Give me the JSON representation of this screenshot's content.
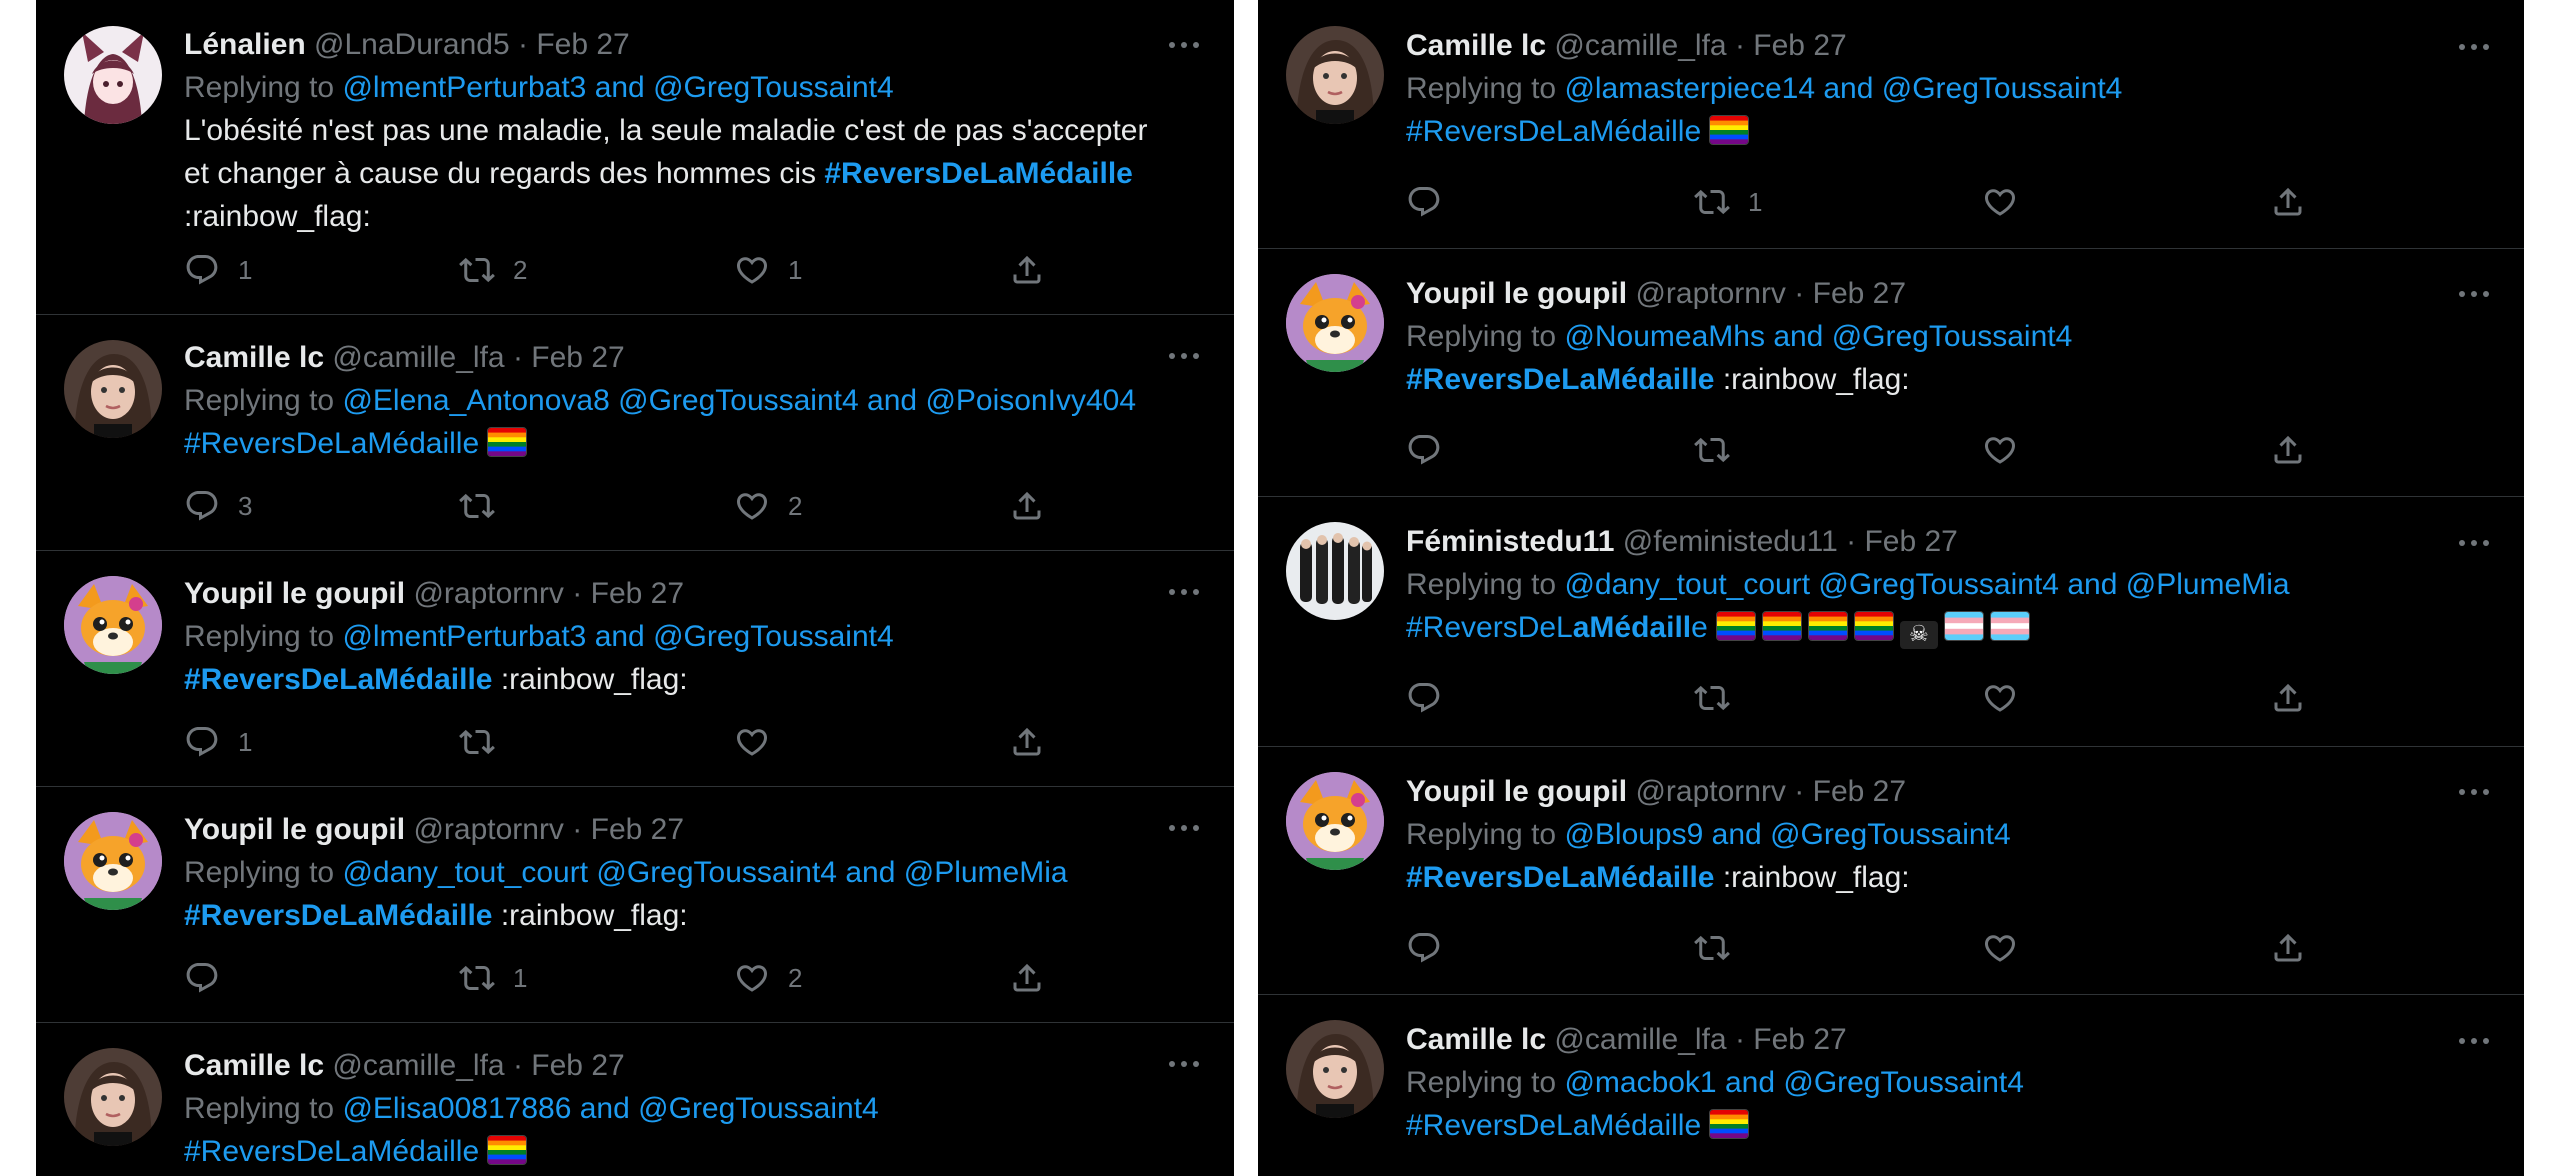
{
  "left": {
    "tweets": [
      {
        "name": "Lénalien",
        "handle": "@LnaDurand5",
        "date": "Feb 27",
        "reply_prefix": "Replying to",
        "mention1": "@lmentPerturbat3",
        "and": "and",
        "mention2": "@GregToussaint4",
        "text_line1": "L'obésité n'est pas une maladie, la seule maladie c'est de pas s'accepter",
        "text_line2": "et changer à cause du regards des hommes cis",
        "hashtag": "#ReversDeLaMédaille",
        "text_line3": ":rainbow_flag:",
        "replies": "1",
        "retweets": "2",
        "likes": "1"
      },
      {
        "name": "Camille lc",
        "handle": "@camille_lfa",
        "date": "Feb 27",
        "reply_prefix": "Replying to",
        "mention1": "@Elena_Antonova8",
        "mention2": "@GregToussaint4",
        "and": "and",
        "mention3": "@PoisonIvy404",
        "hashtag": "#ReversDeLaMédaille",
        "replies": "3",
        "retweets": "",
        "likes": "2"
      },
      {
        "name": "Youpil le goupil",
        "handle": "@raptornrv",
        "date": "Feb 27",
        "reply_prefix": "Replying to",
        "mention1": "@lmentPerturbat3",
        "and": "and",
        "mention2": "@GregToussaint4",
        "hashtag": "#ReversDeLaMédaille",
        "emoji_text": ":rainbow_flag:",
        "replies": "1",
        "retweets": "",
        "likes": ""
      },
      {
        "name": "Youpil le goupil",
        "handle": "@raptornrv",
        "date": "Feb 27",
        "reply_prefix": "Replying to",
        "mention1": "@dany_tout_court",
        "mention2": "@GregToussaint4",
        "and": "and",
        "mention3": "@PlumeMia",
        "hashtag": "#ReversDeLaMédaille",
        "emoji_text": ":rainbow_flag:",
        "replies": "",
        "retweets": "1",
        "likes": "2"
      },
      {
        "name": "Camille lc",
        "handle": "@camille_lfa",
        "date": "Feb 27",
        "reply_prefix": "Replying to",
        "mention1": "@Elisa00817886",
        "and": "and",
        "mention2": "@GregToussaint4",
        "hashtag": "#ReversDeLaMédaille"
      }
    ]
  },
  "right": {
    "tweets": [
      {
        "name": "Camille lc",
        "handle": "@camille_lfa",
        "date": "Feb 27",
        "reply_prefix": "Replying to",
        "mention1": "@lamasterpiece14",
        "and": "and",
        "mention2": "@GregToussaint4",
        "hashtag": "#ReversDeLaMédaille",
        "replies": "",
        "retweets": "1",
        "likes": ""
      },
      {
        "name": "Youpil le goupil",
        "handle": "@raptornrv",
        "date": "Feb 27",
        "reply_prefix": "Replying to",
        "mention1": "@NoumeaMhs",
        "and": "and",
        "mention2": "@GregToussaint4",
        "hashtag": "#ReversDeLaMédaille",
        "emoji_text": ":rainbow_flag:",
        "replies": "",
        "retweets": "",
        "likes": ""
      },
      {
        "name": "Féministedu11",
        "handle": "@feministedu11",
        "date": "Feb 27",
        "reply_prefix": "Replying to",
        "mention1": "@dany_tout_court",
        "mention2": "@GregToussaint4",
        "and": "and",
        "mention3": "@PlumeMia",
        "hashtag_a": "#ReversDeL",
        "hashtag_b": "aMédaill",
        "hashtag_c": "e",
        "skull": "☠",
        "replies": "",
        "retweets": "",
        "likes": ""
      },
      {
        "name": "Youpil le goupil",
        "handle": "@raptornrv",
        "date": "Feb 27",
        "reply_prefix": "Replying to",
        "mention1": "@Bloups9",
        "and": "and",
        "mention2": "@GregToussaint4",
        "hashtag": "#ReversDeLaMédaille",
        "emoji_text": ":rainbow_flag:",
        "replies": "",
        "retweets": "",
        "likes": ""
      },
      {
        "name": "Camille lc",
        "handle": "@camille_lfa",
        "date": "Feb 27",
        "reply_prefix": "Replying to",
        "mention1": "@macbok1",
        "and": "and",
        "mention2": "@GregToussaint4",
        "hashtag": "#ReversDeLaMédaille"
      }
    ]
  },
  "meta_separator": "·",
  "colors": {
    "background": "#000000",
    "text": "#e7e9ea",
    "secondary": "#71767b",
    "link": "#1d9bf0",
    "divider": "#2f3336"
  },
  "icons": [
    "reply-icon",
    "retweet-icon",
    "like-icon",
    "share-icon",
    "more-icon",
    "rainbow-flag-icon",
    "trans-flag-icon",
    "pirate-flag-icon"
  ]
}
